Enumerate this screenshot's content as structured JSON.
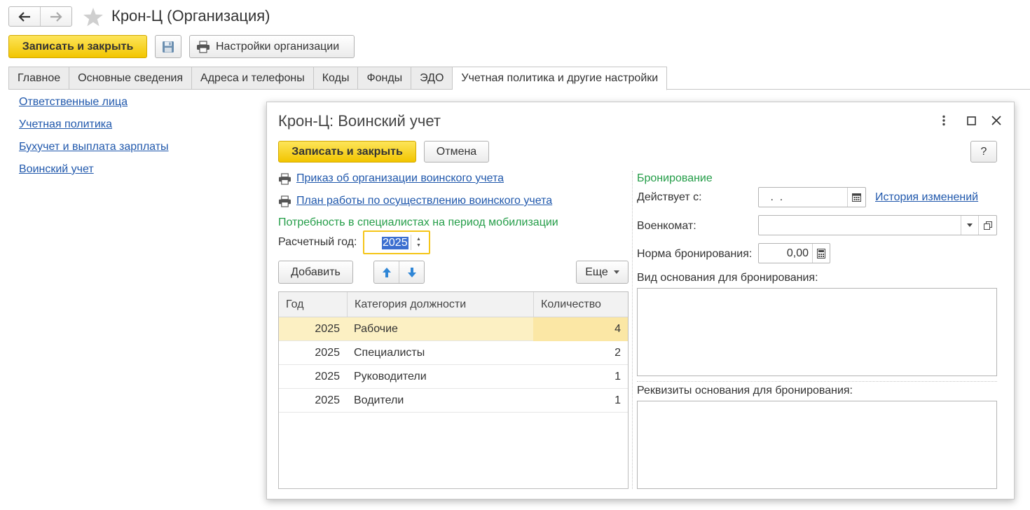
{
  "window": {
    "title": "Крон-Ц (Организация)"
  },
  "toolbar": {
    "save_close_label": "Записать и закрыть",
    "settings_label": "Настройки организации"
  },
  "tabs": [
    {
      "label": "Главное"
    },
    {
      "label": "Основные сведения"
    },
    {
      "label": "Адреса и телефоны"
    },
    {
      "label": "Коды"
    },
    {
      "label": "Фонды"
    },
    {
      "label": "ЭДО"
    },
    {
      "label": "Учетная политика и другие настройки",
      "active": true
    }
  ],
  "sidebar": {
    "links": [
      {
        "label": "Ответственные лица"
      },
      {
        "label": "Учетная политика"
      },
      {
        "label": "Бухучет и выплата зарплаты"
      },
      {
        "label": "Воинский учет"
      }
    ]
  },
  "dialog": {
    "title": "Крон-Ц: Воинский учет",
    "save_close_label": "Записать и закрыть",
    "cancel_label": "Отмена",
    "help_label": "?",
    "print_links": [
      {
        "label": "Приказ об организации воинского учета"
      },
      {
        "label": "План работы по осуществлению воинского учета"
      }
    ],
    "need_section_title": "Потребность в специалистах на период мобилизации",
    "calc_year_label": "Расчетный год:",
    "calc_year_value": "2025",
    "add_label": "Добавить",
    "more_label": "Еще",
    "table": {
      "headers": [
        "Год",
        "Категория должности",
        "Количество"
      ],
      "rows": [
        {
          "year": "2025",
          "category": "Рабочие",
          "qty": "4",
          "selected": true
        },
        {
          "year": "2025",
          "category": "Специалисты",
          "qty": "2"
        },
        {
          "year": "2025",
          "category": "Руководители",
          "qty": "1"
        },
        {
          "year": "2025",
          "category": "Водители",
          "qty": "1"
        }
      ]
    },
    "booking": {
      "section_title": "Бронирование",
      "valid_from_label": "Действует с:",
      "valid_from_value": " .  .",
      "history_link": "История изменений",
      "military_office_label": "Военкомат:",
      "military_office_value": "",
      "norm_label": "Норма бронирования:",
      "norm_value": "0,00",
      "basis_type_label": "Вид основания для бронирования:",
      "basis_details_label": "Реквизиты основания для бронирования:"
    }
  },
  "colors": {
    "accent_yellow": "#f5c518",
    "link_blue": "#2058ac",
    "section_green": "#249d48",
    "selection_blue": "#3c6fd0",
    "row_selected": "#fcf0c3",
    "arrow_blue": "#2f86d6"
  },
  "icons": {
    "back": "arrow-left-icon",
    "forward": "arrow-right-icon",
    "favorite": "star-icon",
    "save": "floppy-disk-icon",
    "print": "printer-icon",
    "menu": "vertical-dots-icon",
    "maximize": "maximize-icon",
    "close": "close-icon",
    "calendar": "calendar-icon",
    "dropdown": "chevron-down-icon",
    "open": "open-window-icon",
    "calculator": "calculator-icon",
    "move_up": "arrow-up-icon",
    "move_down": "arrow-down-icon"
  }
}
